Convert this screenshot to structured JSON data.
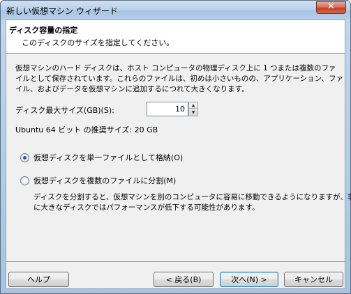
{
  "window": {
    "title": "新しい仮想マシン ウィザード",
    "close_glyph": "✕"
  },
  "header": {
    "title": "ディスク容量の指定",
    "subtitle": "このディスクのサイズを指定してください。"
  },
  "description": {
    "lines": [
      "仮想マシンのハード ディスクは、ホスト コンピュータの物理ディスク上に 1 つまたは複数のファ",
      "イルとして保存されています。これらのファイルは、初めは小さいものの、アプリケーション、ファ",
      "イル、およびデータを仮想マシンに追加するにつれて大きくなります。"
    ]
  },
  "disk_size": {
    "label": "ディスク最大サイズ(GB)(S):",
    "value": "10",
    "up_glyph": "▲",
    "down_glyph": "▼"
  },
  "recommended": "Ubuntu 64 ビット の推奨サイズ: 20 GB",
  "options": {
    "single_file": {
      "label": "仮想ディスクを単一ファイルとして格納(O)",
      "checked": true
    },
    "split_files": {
      "label": "仮想ディスクを複数のファイルに分割(M)",
      "checked": false,
      "description": [
        "ディスクを分割すると、仮想マシンを別のコンピュータに容易に移動できるようになりますが、非常",
        "に大きなディスクではパフォーマンスが低下する可能性があります。"
      ]
    }
  },
  "buttons": {
    "help": "ヘルプ",
    "back": "< 戻る(B)",
    "next": "次へ(N) >",
    "cancel": "キャンセル"
  }
}
